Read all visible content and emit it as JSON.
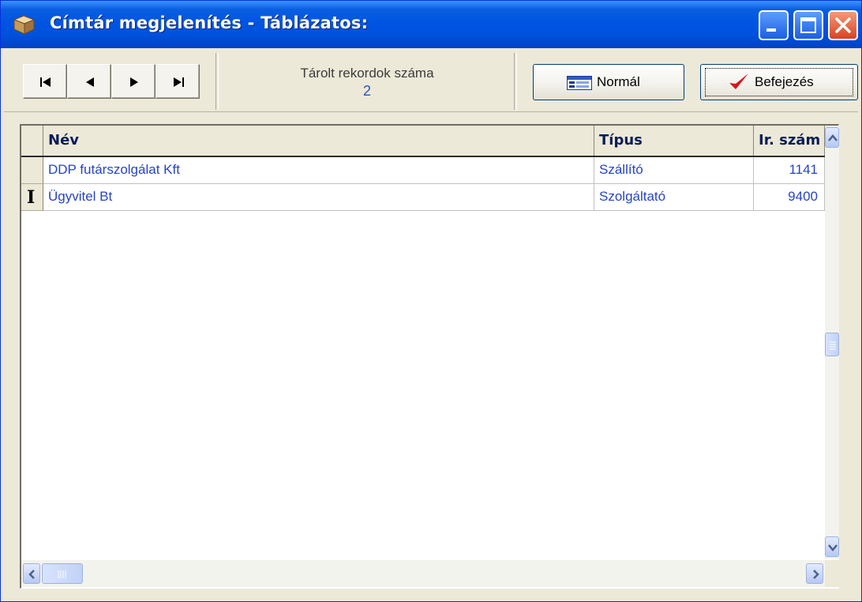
{
  "window": {
    "title": "Címtár megjelenítés - Táblázatos:",
    "app_icon": "box-icon",
    "buttons": [
      "minimize-icon",
      "maximize-icon",
      "close-icon"
    ]
  },
  "toolbar": {
    "nav_icons": [
      "first-record-icon",
      "previous-record-icon",
      "next-record-icon",
      "last-record-icon"
    ],
    "record_count_label": "Tárolt rekordok száma",
    "record_count_value": "2",
    "normal_button_label": "Normál",
    "normal_button_icon": "form-view-icon",
    "finish_button_label": "Befejezés",
    "finish_button_icon": "checkmark-icon"
  },
  "table": {
    "columns": [
      "Név",
      "Típus",
      "Ir. szám"
    ],
    "rows": [
      {
        "name": "DDP futárszolgálat Kft",
        "type": "Szállító",
        "zip": "1141",
        "current": false
      },
      {
        "name": "Ügyvitel Bt",
        "type": "Szolgáltató",
        "zip": "9400",
        "current": true
      }
    ]
  },
  "colors": {
    "title_bar": "#0054e3",
    "data_text": "#2744c7",
    "record_count": "#2a52c9",
    "check_red": "#d8141c"
  }
}
